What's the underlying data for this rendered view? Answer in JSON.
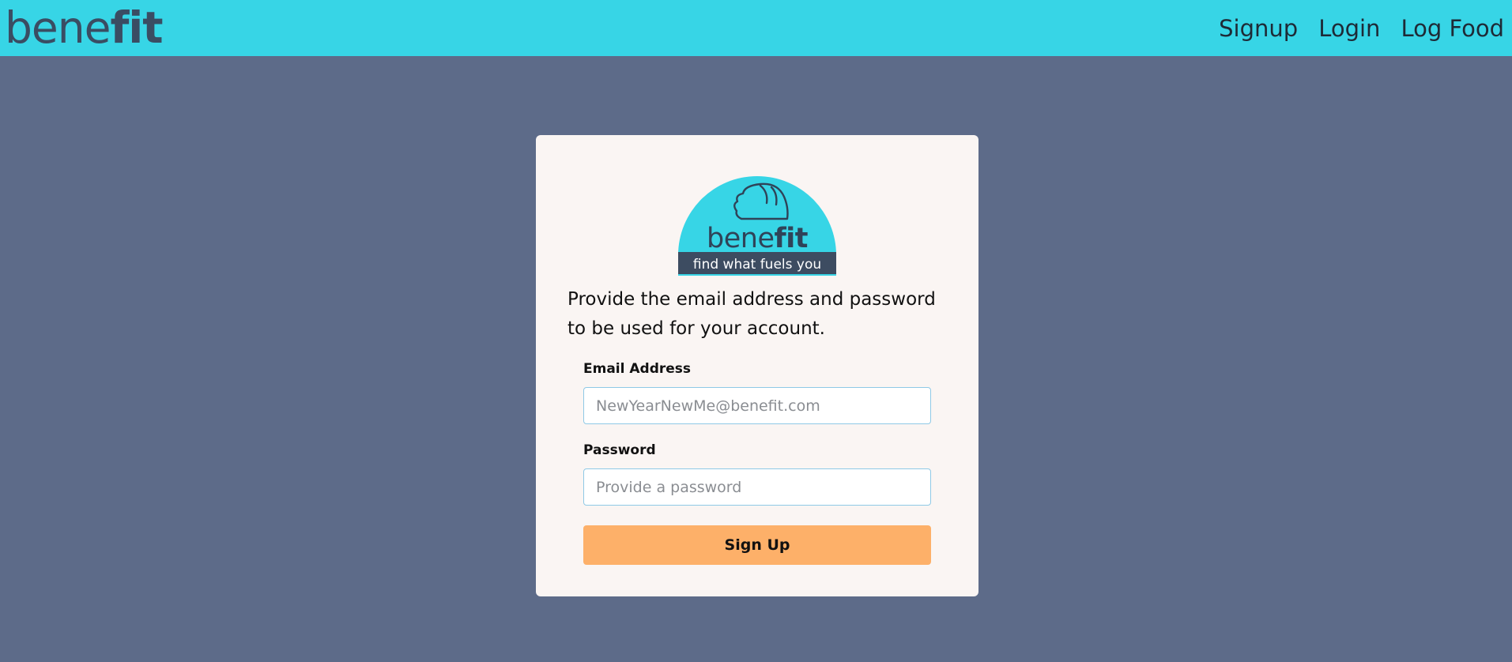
{
  "navbar": {
    "brand_light": "bene",
    "brand_bold": "fit",
    "links": [
      {
        "label": "Signup"
      },
      {
        "label": "Login"
      },
      {
        "label": "Log Food"
      }
    ]
  },
  "logo": {
    "name_light": "bene",
    "name_bold": "fit",
    "tagline": "find what fuels you",
    "icon": "bread-loaf-icon"
  },
  "form": {
    "intro": "Provide the email address and password to be used for your account.",
    "email_label": "Email Address",
    "email_placeholder": "NewYearNewMe@benefit.com",
    "email_value": "",
    "password_label": "Password",
    "password_placeholder": "Provide a password",
    "password_value": "",
    "submit_label": "Sign Up"
  },
  "colors": {
    "navbar": "#37d5e6",
    "page_background": "#5d6b89",
    "card": "#faf5f3",
    "brand_text": "#3a4d63",
    "logo_banner": "#3d4c61",
    "button": "#fdb069"
  }
}
